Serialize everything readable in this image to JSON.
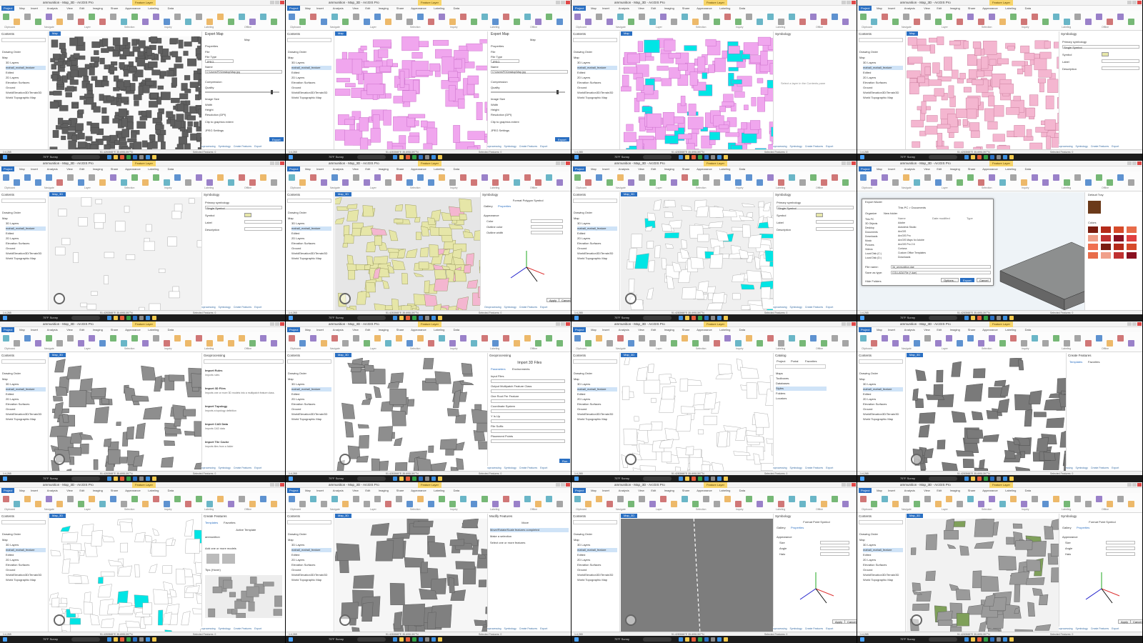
{
  "app": {
    "title": "ammunition - Map_3D - ArcGIS Pro",
    "contextual_tab": "Feature Layer",
    "ribbon_tabs": [
      "Project",
      "Map",
      "Insert",
      "Analysis",
      "View",
      "Edit",
      "Imaging",
      "Share",
      "Appearance",
      "Labeling",
      "Data"
    ],
    "ribbon_groups": [
      "Clipboard",
      "Navigate",
      "Layer",
      "Selection",
      "Inquiry",
      "Labeling",
      "Offline"
    ],
    "map_tab": "Map",
    "map_tab_3d": "Map_3D"
  },
  "contents": {
    "title": "Contents",
    "search_placeholder": "Search",
    "drawing_order": "Drawing Order",
    "items": [
      "Map",
      "3D Layers",
      "mahall_mahall_feature",
      "Edited",
      "2D Layers",
      "Elevation Surfaces",
      "Ground",
      "WorldElevation3D/Terrain3D",
      "World Topographic Map"
    ]
  },
  "export_map": {
    "title": "Export Map",
    "map_label": "Map",
    "properties": "Properties",
    "file": "File",
    "file_type_label": "File Type",
    "file_type_value": "JPEG",
    "name_label": "Name",
    "name_value": "C:\\Users\\PC\\Desktop\\Map.jpg",
    "compression": "Compression",
    "quality": "Quality",
    "image_size": "Image Size",
    "width_label": "Width",
    "height_label": "Height",
    "resolution_label": "Resolution (DPI)",
    "clip_label": "Clip to graphics extent",
    "jpeg_settings": "JPEG Settings",
    "export_button": "Export"
  },
  "symbology": {
    "title": "Symbology",
    "primary": "Primary symbology",
    "single_symbol": "Single Symbol",
    "symbol_label": "Symbol",
    "label_label": "Label",
    "description_label": "Description",
    "select_layer_hint": "Select a layer in the Contents pane",
    "format_symbol": "Format Polygon Symbol",
    "format_point_symbol": "Format Point Symbol",
    "gallery": "Gallery",
    "properties": "Properties",
    "appearance": "Appearance",
    "color": "Color",
    "outline_color": "Outline color",
    "outline_width": "Outline width",
    "size": "Size",
    "angle": "Angle",
    "halo": "Halo",
    "apply": "Apply",
    "cancel": "Cancel"
  },
  "geoprocessing": {
    "title": "Geoprocessing",
    "tools": [
      {
        "name": "Import Rules",
        "desc": "Imports rules"
      },
      {
        "name": "Import 3D Files",
        "desc": "Imports one or more 3D models into a multipatch feature class."
      },
      {
        "name": "Import Topology",
        "desc": "Imports a topology definition"
      },
      {
        "name": "Import CAD Data",
        "desc": "Imports CAD data"
      },
      {
        "name": "Import Tile Cache",
        "desc": "Imports tiles from a folder"
      }
    ],
    "import_3d": {
      "title": "Import 3D Files",
      "parameters": "Parameters",
      "environments": "Environments",
      "input_files": "Input Files",
      "output_multipatch": "Output Multipatch Feature Class",
      "root_per_feature": "One Root Per Feature",
      "coordinate_system": "Coordinate System",
      "y_is_up": "Y Is Up",
      "file_suffix": "File Suffix",
      "placement_points": "Placement Points",
      "run": "Run"
    }
  },
  "export_dialog": {
    "title": "Export Model",
    "path": "This PC > Documents",
    "organize": "Organize",
    "new_folder": "New folder",
    "columns": [
      "Name",
      "Date modified",
      "Type"
    ],
    "nav": [
      "This PC",
      "3D Objects",
      "Desktop",
      "Documents",
      "Downloads",
      "Music",
      "Pictures",
      "Videos",
      "Local Disk (C:)",
      "Local Disk (D:)"
    ],
    "files": [
      "Adobe",
      "Autodesk Studio",
      "ArcGIS",
      "ArcGIS Pro",
      "ArcGIS Maps for Adobe",
      "ArcGIS Pro 2.6",
      "Cortona",
      "Custom Office Templates",
      "Downloads"
    ],
    "file_name_label": "File name:",
    "file_name_value": "3d_ammunition.dae",
    "save_type_label": "Save as type:",
    "save_type_value": "COLLADA File (*.dae)",
    "hide_folders": "Hide Folders",
    "options": "Options...",
    "export": "Export",
    "cancel": "Cancel",
    "default_tray": "Default Tray",
    "colors": "Colors"
  },
  "catalog": {
    "title": "Catalog",
    "tabs": [
      "Project",
      "Portal",
      "Favorites"
    ],
    "items": [
      "Maps",
      "Toolboxes",
      "Databases",
      "Styles",
      "Folders",
      "Locators"
    ]
  },
  "create_features": {
    "title": "Create Features",
    "templates": "Templates",
    "favorites": "Favorites",
    "active_template": "Active Template",
    "layer": "ammunition",
    "add_hint": "Add one or more models",
    "tips": "Tips (Hover)"
  },
  "modify_features": {
    "title": "Modify Features",
    "tool": "Move",
    "items": [
      "Move/Rotate/Scale features completed",
      "Make a selection",
      "Select one or more features"
    ]
  },
  "status": {
    "scale": "1:4,265",
    "coords": "51.4283565°E 35.6951397°N",
    "selected": "Selected Features: 0"
  },
  "bottom_tabs": [
    "Geoprocessing",
    "Symbology",
    "Create Features",
    "Export"
  ],
  "taskbar": {
    "weather": "75°F  Sunny"
  },
  "colors": {
    "accent": "#2a6fc2",
    "selection": "#00e5e5",
    "magenta": "#f0a6ee",
    "pink": "#f4b6d0",
    "building_yellow": "#e6e6a8",
    "building_gray": "#8e8e8e",
    "contextual": "#f7d56b"
  }
}
